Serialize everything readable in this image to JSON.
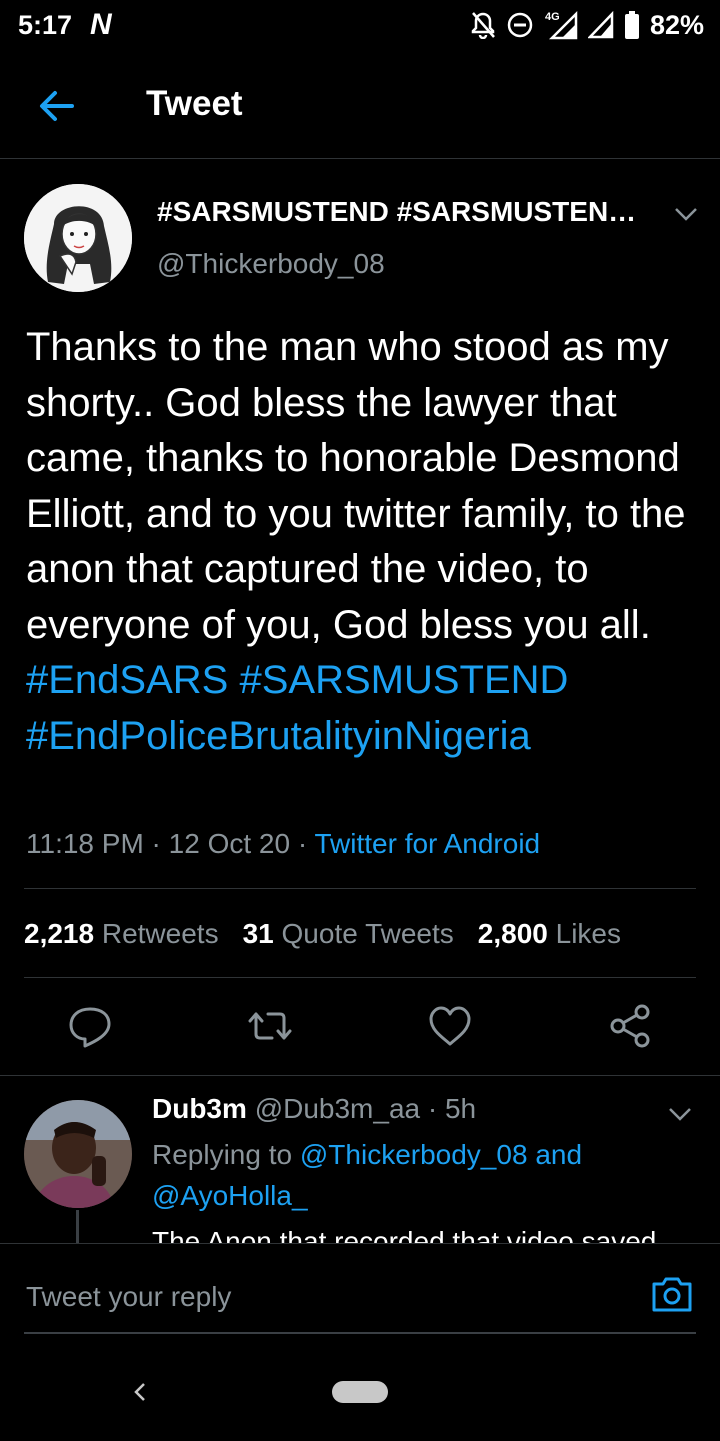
{
  "status_bar": {
    "time": "5:17",
    "notification_letter": "N",
    "network": "4G",
    "battery": "82%"
  },
  "header": {
    "title": "Tweet",
    "back_icon": "arrow-left-icon"
  },
  "tweet": {
    "display_name": "#SARSMUSTEND #SARSMUSTEN…",
    "handle": "@Thickerbody_08",
    "text_plain": "Thanks to the man who stood as my shorty.. God bless the lawyer that came, thanks to honorable Desmond Elliott, and to you twitter family, to the anon that captured the video, to everyone of you, God bless you all.",
    "hashtags": [
      "#EndSARS",
      "#SARSMUSTEND",
      "#EndPoliceBrutalityinNigeria"
    ],
    "time": "11:18 PM",
    "date": "12 Oct 20",
    "source": "Twitter for Android",
    "separator": " · ",
    "stats": {
      "retweets_count": "2,218",
      "retweets_label": "Retweets",
      "quotes_count": "31",
      "quotes_label": "Quote Tweets",
      "likes_count": "2,800",
      "likes_label": "Likes"
    },
    "actions": [
      "reply-icon",
      "retweet-icon",
      "like-icon",
      "share-icon"
    ]
  },
  "reply": {
    "name": "Dub3m",
    "handle": "@Dub3m_aa",
    "separator": " · ",
    "time": "5h",
    "replying_prefix": "Replying to",
    "mention1": "@Thickerbody_08",
    "and_word": "and",
    "mention2": "@AyoHolla_",
    "text": "The Anon that recorded that video saved"
  },
  "composer": {
    "placeholder": "Tweet your reply",
    "camera_icon": "camera-icon"
  },
  "colors": {
    "background": "#000000",
    "accent": "#1da1f2",
    "secondary_text": "#8b949a",
    "divider": "#2f3336"
  }
}
